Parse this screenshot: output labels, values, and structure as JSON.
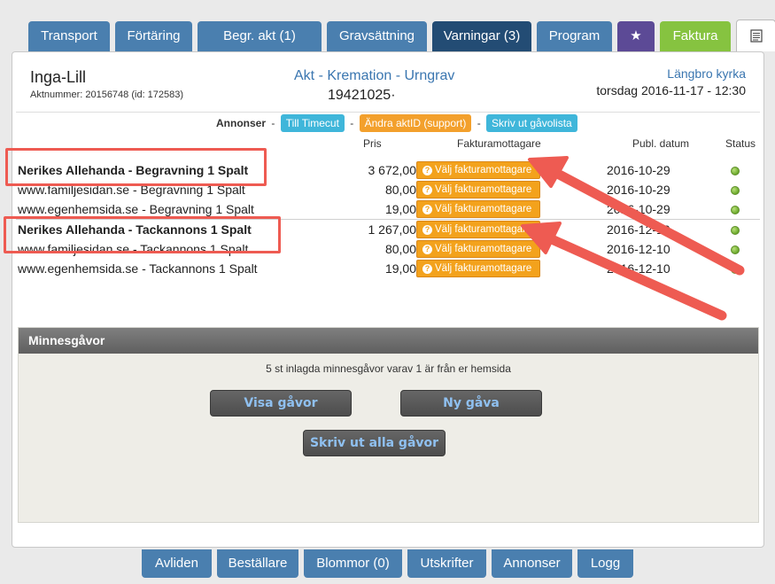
{
  "tabs": [
    {
      "label": "Transport"
    },
    {
      "label": "Förtäring"
    },
    {
      "label": "Begr. akt (1)"
    },
    {
      "label": "Gravsättning"
    },
    {
      "label": "Varningar (3)"
    },
    {
      "label": "Program"
    },
    {
      "label": "★"
    },
    {
      "label": "Faktura"
    },
    {
      "label": ""
    }
  ],
  "header": {
    "name": "Inga-Lill",
    "aktnummer": "Aktnummer: 20156748 (id: 172583)",
    "title": "Akt - Kremation - Urngrav",
    "number": "19421025·",
    "church": "Längbro kyrka",
    "datetime": "torsdag 2016-11-17 - 12:30"
  },
  "annonser": {
    "label": "Annonser",
    "sep": "-",
    "buttons": [
      "Till Timecut",
      "Ändra aktID (support)",
      "Skriv ut gåvolista"
    ]
  },
  "columns": {
    "pris": "Pris",
    "mottagare": "Fakturamottagare",
    "publ": "Publ. datum",
    "status": "Status"
  },
  "rows": [
    {
      "name": "Nerikes Allehanda - Begravning 1 Spalt",
      "price": "3 672,00",
      "button": "Välj fakturamottagare",
      "date": "2016-10-29",
      "bold": true
    },
    {
      "name": "www.familjesidan.se - Begravning 1 Spalt",
      "price": "80,00",
      "button": "Välj fakturamottagare",
      "date": "2016-10-29",
      "bold": false
    },
    {
      "name": "www.egenhemsida.se - Begravning 1 Spalt",
      "price": "19,00",
      "button": "Välj fakturamottagare",
      "date": "2016-10-29",
      "bold": false
    },
    {
      "name": "Nerikes Allehanda - Tackannons 1 Spalt",
      "price": "1 267,00",
      "button": "Välj fakturamottagare",
      "date": "2016-12-10",
      "bold": true
    },
    {
      "name": "www.familjesidan.se - Tackannons 1 Spalt",
      "price": "80,00",
      "button": "Välj fakturamottagare",
      "date": "2016-12-10",
      "bold": false
    },
    {
      "name": "www.egenhemsida.se - Tackannons 1 Spalt",
      "price": "19,00",
      "button": "Välj fakturamottagare",
      "date": "2016-12-10",
      "bold": false
    }
  ],
  "minnesgavor": {
    "title": "Minnesgåvor",
    "info": "5 st inlagda minnesgåvor varav 1 är från er hemsida",
    "visa": "Visa gåvor",
    "ny": "Ny gåva",
    "skriv": "Skriv ut alla gåvor"
  },
  "bottom_tabs": [
    {
      "label": "Avliden"
    },
    {
      "label": "Beställare"
    },
    {
      "label": "Blommor (0)"
    },
    {
      "label": "Utskrifter"
    },
    {
      "label": "Annonser"
    },
    {
      "label": "Logg"
    }
  ],
  "colors": {
    "tab": "#4a7faf",
    "tab_active": "#234c74",
    "orange": "#f3a21c",
    "cyan": "#3fb6da",
    "annotation": "#ee5b52",
    "status_ok": "#6aa82a"
  },
  "icons": [
    "star-icon",
    "notepad-icon",
    "question-icon",
    "status-dot-icon"
  ]
}
